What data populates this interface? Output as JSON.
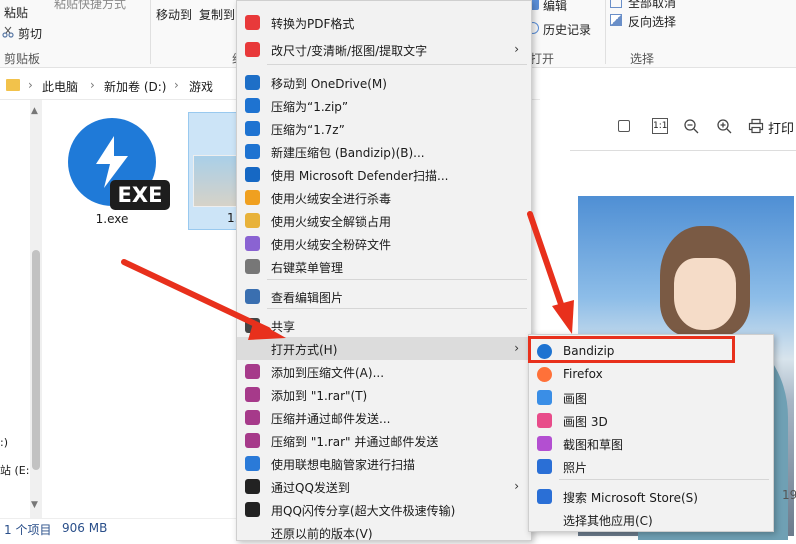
{
  "ribbon": {
    "paste_label": "粘贴",
    "paste_shortcut_label": "粘贴快捷方式",
    "cut_label": "剪切",
    "clipboard_group": "剪贴板",
    "move_to_label": "移动到",
    "copy_to_label": "复制到",
    "edit_label": "编辑",
    "history_label": "历史记录",
    "open_group_fragment": "打开",
    "select_none_label": "全部取消",
    "invert_selection_label": "反向选择",
    "select_group": "选择",
    "organize_group_fragment": "组"
  },
  "address_bar": {
    "crumbs": [
      "此电脑",
      "新加卷 (D:)",
      "游戏"
    ]
  },
  "files": [
    {
      "name": "1.exe",
      "badge": "EXE"
    },
    {
      "name": "1."
    }
  ],
  "left_pane": {
    "item1": ":)",
    "item2": "站 (E:"
  },
  "status_bar": {
    "count": "1 个项目",
    "size": "906 MB"
  },
  "preview_toolbar": {
    "icons": [
      "print-icon",
      "zoom-in-icon",
      "zoom-out-icon",
      "actual-size-icon",
      "page-icon"
    ],
    "print_label": "打印"
  },
  "preview": {
    "page_fragment": "19"
  },
  "context_menu": {
    "items": [
      {
        "label": "转换为PDF格式",
        "icon": "pdf-convert-icon",
        "color": "#e8393a"
      },
      {
        "label": "改尺寸/变清晰/抠图/提取文字",
        "icon": "image-tool-icon",
        "color": "#e8393a",
        "submenu": true
      },
      {
        "label": "移动到 OneDrive(M)",
        "icon": "onedrive-icon",
        "color": "#1e6fc7"
      },
      {
        "label": "压缩为“1.zip”",
        "icon": "bandizip-icon",
        "color": "#1e73d1"
      },
      {
        "label": "压缩为“1.7z”",
        "icon": "bandizip-icon",
        "color": "#1e73d1"
      },
      {
        "label": "新建压缩包 (Bandizip)(B)...",
        "icon": "bandizip-icon",
        "color": "#1e73d1"
      },
      {
        "label": "使用 Microsoft Defender扫描...",
        "icon": "defender-shield-icon",
        "color": "#1668c4"
      },
      {
        "label": "使用火绒安全进行杀毒",
        "icon": "huorong-icon",
        "color": "#f0a020"
      },
      {
        "label": "使用火绒安全解锁占用",
        "icon": "folder-unlock-icon",
        "color": "#e8b23a"
      },
      {
        "label": "使用火绒安全粉碎文件",
        "icon": "shredder-icon",
        "color": "#8a63d2"
      },
      {
        "label": "右键菜单管理",
        "icon": "mouse-icon",
        "color": "#777777"
      },
      {
        "label": "查看编辑图片",
        "icon": "image-viewer-icon",
        "color": "#3a6fb0"
      },
      {
        "label": "共享",
        "icon": "share-icon",
        "color": "#444444"
      },
      {
        "label": "打开方式(H)",
        "icon": "",
        "color": "",
        "submenu": true
      },
      {
        "label": "添加到压缩文件(A)...",
        "icon": "winrar-icon",
        "color": "#a63a8a"
      },
      {
        "label": "添加到 \"1.rar\"(T)",
        "icon": "winrar-icon",
        "color": "#a63a8a"
      },
      {
        "label": "压缩并通过邮件发送...",
        "icon": "winrar-icon",
        "color": "#a63a8a"
      },
      {
        "label": "压缩到 \"1.rar\" 并通过邮件发送",
        "icon": "winrar-icon",
        "color": "#a63a8a"
      },
      {
        "label": "使用联想电脑管家进行扫描",
        "icon": "lenovo-shield-icon",
        "color": "#2a7ad8"
      },
      {
        "label": "通过QQ发送到",
        "icon": "qq-icon",
        "color": "#222222",
        "submenu": true
      },
      {
        "label": "用QQ闪传分享(超大文件极速传输)",
        "icon": "qq-icon",
        "color": "#222222"
      },
      {
        "label": "还原以前的版本(V)",
        "icon": "",
        "color": ""
      }
    ]
  },
  "open_with_submenu": {
    "items": [
      {
        "label": "Bandizip",
        "icon": "bandizip-icon",
        "color": "#1e73d1"
      },
      {
        "label": "Firefox",
        "icon": "firefox-icon",
        "color": "#ff7139"
      },
      {
        "label": "画图",
        "icon": "paint-icon",
        "color": "#3a8ee6"
      },
      {
        "label": "画图 3D",
        "icon": "paint-3d-icon",
        "color": "#e84c8a"
      },
      {
        "label": "截图和草图",
        "icon": "snip-sketch-icon",
        "color": "#b34fd1"
      },
      {
        "label": "照片",
        "icon": "photos-icon",
        "color": "#2a6fd6"
      },
      {
        "label": "搜索 Microsoft Store(S)",
        "icon": "store-icon",
        "color": "#2a6fd6"
      },
      {
        "label": "选择其他应用(C)",
        "icon": "",
        "color": ""
      }
    ]
  },
  "annotation": {
    "highlight_color": "#e8301c",
    "arrow_color": "#e8301c"
  }
}
